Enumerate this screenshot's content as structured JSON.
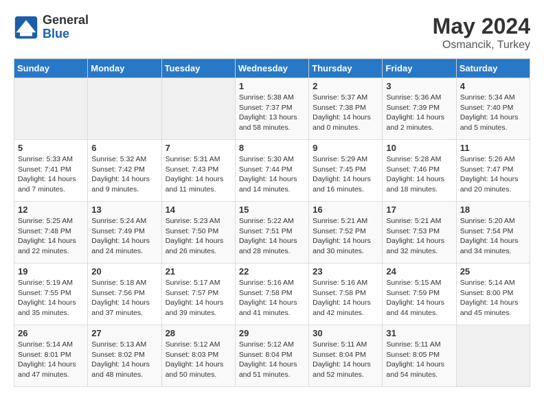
{
  "logo": {
    "general": "General",
    "blue": "Blue"
  },
  "title": {
    "month": "May 2024",
    "location": "Osmancik, Turkey"
  },
  "headers": [
    "Sunday",
    "Monday",
    "Tuesday",
    "Wednesday",
    "Thursday",
    "Friday",
    "Saturday"
  ],
  "weeks": [
    [
      {
        "day": "",
        "content": ""
      },
      {
        "day": "",
        "content": ""
      },
      {
        "day": "",
        "content": ""
      },
      {
        "day": "1",
        "content": "Sunrise: 5:38 AM\nSunset: 7:37 PM\nDaylight: 13 hours\nand 58 minutes."
      },
      {
        "day": "2",
        "content": "Sunrise: 5:37 AM\nSunset: 7:38 PM\nDaylight: 14 hours\nand 0 minutes."
      },
      {
        "day": "3",
        "content": "Sunrise: 5:36 AM\nSunset: 7:39 PM\nDaylight: 14 hours\nand 2 minutes."
      },
      {
        "day": "4",
        "content": "Sunrise: 5:34 AM\nSunset: 7:40 PM\nDaylight: 14 hours\nand 5 minutes."
      }
    ],
    [
      {
        "day": "5",
        "content": "Sunrise: 5:33 AM\nSunset: 7:41 PM\nDaylight: 14 hours\nand 7 minutes."
      },
      {
        "day": "6",
        "content": "Sunrise: 5:32 AM\nSunset: 7:42 PM\nDaylight: 14 hours\nand 9 minutes."
      },
      {
        "day": "7",
        "content": "Sunrise: 5:31 AM\nSunset: 7:43 PM\nDaylight: 14 hours\nand 11 minutes."
      },
      {
        "day": "8",
        "content": "Sunrise: 5:30 AM\nSunset: 7:44 PM\nDaylight: 14 hours\nand 14 minutes."
      },
      {
        "day": "9",
        "content": "Sunrise: 5:29 AM\nSunset: 7:45 PM\nDaylight: 14 hours\nand 16 minutes."
      },
      {
        "day": "10",
        "content": "Sunrise: 5:28 AM\nSunset: 7:46 PM\nDaylight: 14 hours\nand 18 minutes."
      },
      {
        "day": "11",
        "content": "Sunrise: 5:26 AM\nSunset: 7:47 PM\nDaylight: 14 hours\nand 20 minutes."
      }
    ],
    [
      {
        "day": "12",
        "content": "Sunrise: 5:25 AM\nSunset: 7:48 PM\nDaylight: 14 hours\nand 22 minutes."
      },
      {
        "day": "13",
        "content": "Sunrise: 5:24 AM\nSunset: 7:49 PM\nDaylight: 14 hours\nand 24 minutes."
      },
      {
        "day": "14",
        "content": "Sunrise: 5:23 AM\nSunset: 7:50 PM\nDaylight: 14 hours\nand 26 minutes."
      },
      {
        "day": "15",
        "content": "Sunrise: 5:22 AM\nSunset: 7:51 PM\nDaylight: 14 hours\nand 28 minutes."
      },
      {
        "day": "16",
        "content": "Sunrise: 5:21 AM\nSunset: 7:52 PM\nDaylight: 14 hours\nand 30 minutes."
      },
      {
        "day": "17",
        "content": "Sunrise: 5:21 AM\nSunset: 7:53 PM\nDaylight: 14 hours\nand 32 minutes."
      },
      {
        "day": "18",
        "content": "Sunrise: 5:20 AM\nSunset: 7:54 PM\nDaylight: 14 hours\nand 34 minutes."
      }
    ],
    [
      {
        "day": "19",
        "content": "Sunrise: 5:19 AM\nSunset: 7:55 PM\nDaylight: 14 hours\nand 35 minutes."
      },
      {
        "day": "20",
        "content": "Sunrise: 5:18 AM\nSunset: 7:56 PM\nDaylight: 14 hours\nand 37 minutes."
      },
      {
        "day": "21",
        "content": "Sunrise: 5:17 AM\nSunset: 7:57 PM\nDaylight: 14 hours\nand 39 minutes."
      },
      {
        "day": "22",
        "content": "Sunrise: 5:16 AM\nSunset: 7:58 PM\nDaylight: 14 hours\nand 41 minutes."
      },
      {
        "day": "23",
        "content": "Sunrise: 5:16 AM\nSunset: 7:58 PM\nDaylight: 14 hours\nand 42 minutes."
      },
      {
        "day": "24",
        "content": "Sunrise: 5:15 AM\nSunset: 7:59 PM\nDaylight: 14 hours\nand 44 minutes."
      },
      {
        "day": "25",
        "content": "Sunrise: 5:14 AM\nSunset: 8:00 PM\nDaylight: 14 hours\nand 45 minutes."
      }
    ],
    [
      {
        "day": "26",
        "content": "Sunrise: 5:14 AM\nSunset: 8:01 PM\nDaylight: 14 hours\nand 47 minutes."
      },
      {
        "day": "27",
        "content": "Sunrise: 5:13 AM\nSunset: 8:02 PM\nDaylight: 14 hours\nand 48 minutes."
      },
      {
        "day": "28",
        "content": "Sunrise: 5:12 AM\nSunset: 8:03 PM\nDaylight: 14 hours\nand 50 minutes."
      },
      {
        "day": "29",
        "content": "Sunrise: 5:12 AM\nSunset: 8:04 PM\nDaylight: 14 hours\nand 51 minutes."
      },
      {
        "day": "30",
        "content": "Sunrise: 5:11 AM\nSunset: 8:04 PM\nDaylight: 14 hours\nand 52 minutes."
      },
      {
        "day": "31",
        "content": "Sunrise: 5:11 AM\nSunset: 8:05 PM\nDaylight: 14 hours\nand 54 minutes."
      },
      {
        "day": "",
        "content": ""
      }
    ]
  ]
}
